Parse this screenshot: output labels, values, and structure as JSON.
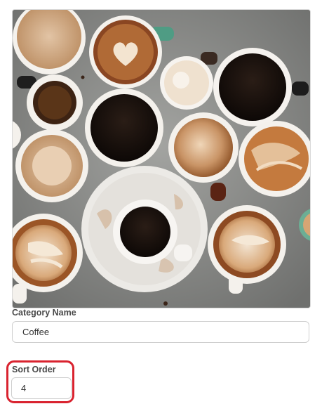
{
  "form": {
    "category_name_label": "Category Name",
    "category_name_value": "Coffee",
    "sort_order_label": "Sort Order",
    "sort_order_value": "4"
  },
  "image": {
    "subject": "top-view coffee cups on grey concrete"
  },
  "colors": {
    "highlight": "#d9232f",
    "border": "#cfcfcf",
    "label": "#4a4a4a"
  }
}
